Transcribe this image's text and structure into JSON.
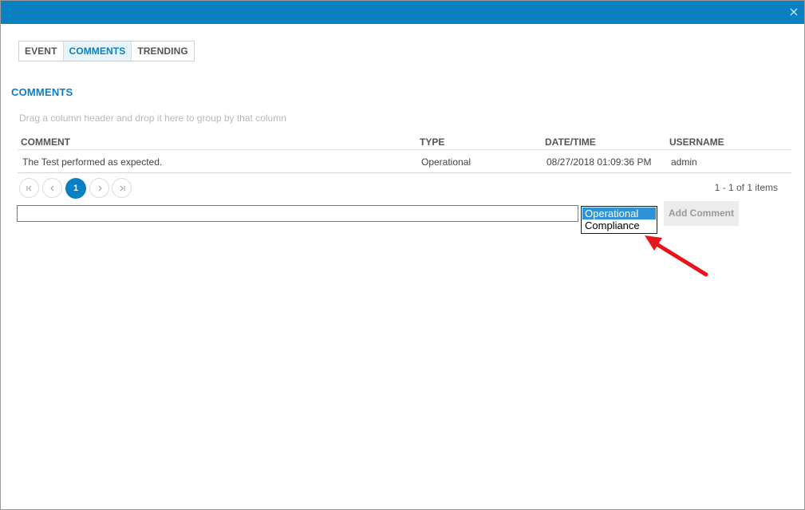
{
  "tabs": [
    {
      "label": "EVENT",
      "active": false
    },
    {
      "label": "COMMENTS",
      "active": true
    },
    {
      "label": "TRENDING",
      "active": false
    }
  ],
  "section_title": "COMMENTS",
  "group_hint": "Drag a column header and drop it here to group by that column",
  "grid": {
    "columns": [
      "COMMENT",
      "TYPE",
      "DATE/TIME",
      "USERNAME"
    ],
    "rows": [
      [
        "The Test performed as expected.",
        "Operational",
        "08/27/2018 01:09:36 PM",
        "admin"
      ]
    ]
  },
  "pager": {
    "current_page": "1",
    "info": "1 - 1 of 1 items"
  },
  "comment_input": {
    "value": "",
    "placeholder": ""
  },
  "type_listbox": {
    "options": [
      "Operational",
      "Compliance"
    ],
    "selected": "Operational"
  },
  "add_button_label": "Add Comment",
  "colors": {
    "titlebar": "#0a7fc2",
    "accent": "#0a7fc2",
    "selected_option": "#2f93d6",
    "annotation_arrow": "#e8141b"
  },
  "icons": {
    "close": "close-icon",
    "first_page": "first-page-icon",
    "prev_page": "prev-page-icon",
    "next_page": "next-page-icon",
    "last_page": "last-page-icon",
    "annotation": "red-arrow-annotation"
  }
}
